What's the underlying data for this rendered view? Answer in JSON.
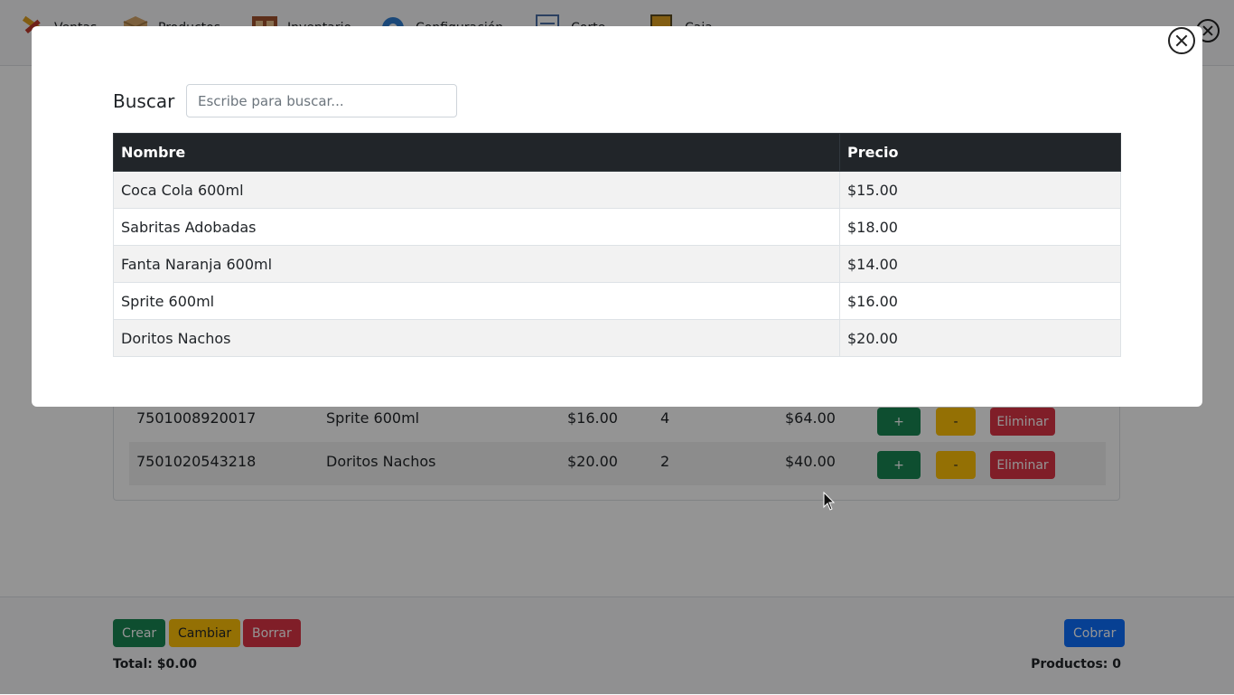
{
  "nav": {
    "items": [
      {
        "icon": "tools-icon",
        "label": "Ventas"
      },
      {
        "icon": "box-icon",
        "label": "Productos"
      },
      {
        "icon": "warehouse-icon",
        "label": "Inventario"
      },
      {
        "icon": "gear-icon",
        "label": "Configuración"
      },
      {
        "icon": "report-icon",
        "label": "Corte"
      },
      {
        "icon": "cash-icon",
        "label": "Caja"
      }
    ]
  },
  "cart": {
    "rows": [
      {
        "code": "7501008920017",
        "name": "Sprite 600ml",
        "price": "$16.00",
        "qty": "4",
        "subtotal": "$64.00",
        "plus": "+",
        "minus": "-",
        "remove": "Eliminar"
      },
      {
        "code": "7501020543218",
        "name": "Doritos Nachos",
        "price": "$20.00",
        "qty": "2",
        "subtotal": "$40.00",
        "plus": "+",
        "minus": "-",
        "remove": "Eliminar"
      }
    ]
  },
  "footer": {
    "create": "Crear",
    "change": "Cambiar",
    "delete": "Borrar",
    "charge": "Cobrar",
    "total": "Total: $0.00",
    "products": "Productos: 0"
  },
  "modal": {
    "search_label": "Buscar",
    "search_placeholder": "Escribe para buscar...",
    "search_value": "",
    "columns": [
      "Nombre",
      "Precio"
    ],
    "rows": [
      {
        "name": "Coca Cola 600ml",
        "price": "$15.00"
      },
      {
        "name": "Sabritas Adobadas",
        "price": "$18.00"
      },
      {
        "name": "Fanta Naranja 600ml",
        "price": "$14.00"
      },
      {
        "name": "Sprite 600ml",
        "price": "$16.00"
      },
      {
        "name": "Doritos Nachos",
        "price": "$20.00"
      }
    ]
  },
  "colors": {
    "success": "#198754",
    "warning": "#ffc107",
    "danger": "#dc3545",
    "primary": "#0d6efd",
    "table_header": "#212529"
  }
}
